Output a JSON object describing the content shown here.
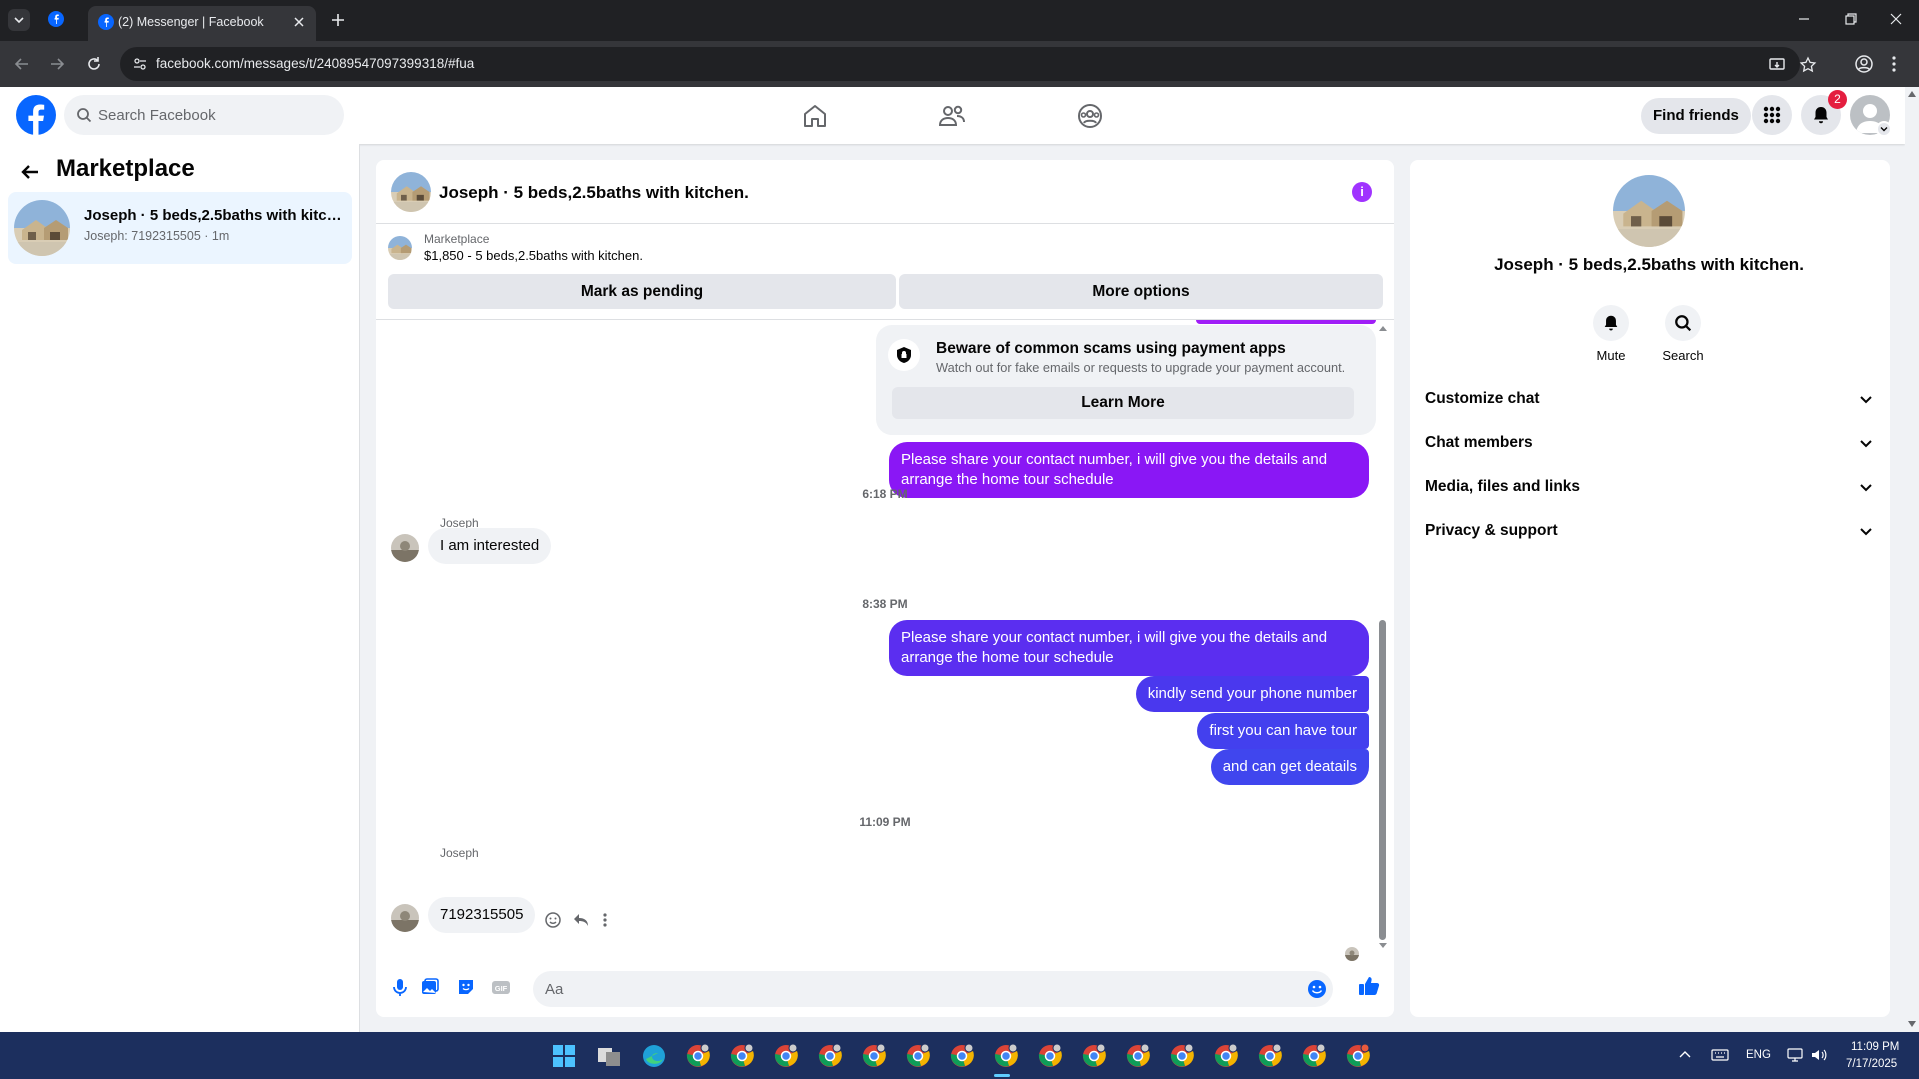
{
  "browser": {
    "tab_title": "(2) Messenger | Facebook",
    "url": "facebook.com/messages/t/24089547097399318/#fua"
  },
  "fb": {
    "search_placeholder": "Search Facebook",
    "find_friends": "Find friends",
    "notification_count": "2",
    "accent": "#0866ff"
  },
  "left": {
    "title": "Marketplace",
    "conversation": {
      "name": "Joseph · 5 beds,2.5baths with kitch...",
      "preview": "Joseph: 7192315505 · 1m"
    }
  },
  "chat": {
    "title": "Joseph · 5 beds,2.5baths with kitchen.",
    "marketplace_label": "Marketplace",
    "listing": "$1,850 - 5 beds,2.5baths with kitchen.",
    "mark_pending": "Mark as pending",
    "more_options": "More options",
    "scam": {
      "title": "Beware of common scams using payment apps",
      "subtitle": "Watch out for fake emails or requests to upgrade your payment account.",
      "button": "Learn More"
    },
    "messages": {
      "out1": "Please share your contact number, i will give you the details and arrange the home tour schedule",
      "ts1": "6:18 PM",
      "sender1": "Joseph",
      "in1": "I am interested",
      "ts2": "8:38 PM",
      "out2": "Please share your contact number, i will give you the details and arrange the home tour schedule",
      "out3": "kindly send your phone number",
      "out4": "first you can have tour",
      "out5": "and can get  deatails",
      "ts3": "11:09 PM",
      "sender2": "Joseph",
      "in2": "7192315505"
    },
    "composer_placeholder": "Aa",
    "outgoing_colors": [
      "#8a17f5",
      "#5b2ef0",
      "#4a38ee",
      "#4340ee"
    ]
  },
  "right": {
    "name": "Joseph · 5 beds,2.5baths with kitchen.",
    "mute": "Mute",
    "search": "Search",
    "sections": [
      "Customize chat",
      "Chat members",
      "Media, files and links",
      "Privacy & support"
    ]
  },
  "taskbar": {
    "lang": "ENG",
    "time": "11:09 PM",
    "date": "7/17/2025"
  }
}
